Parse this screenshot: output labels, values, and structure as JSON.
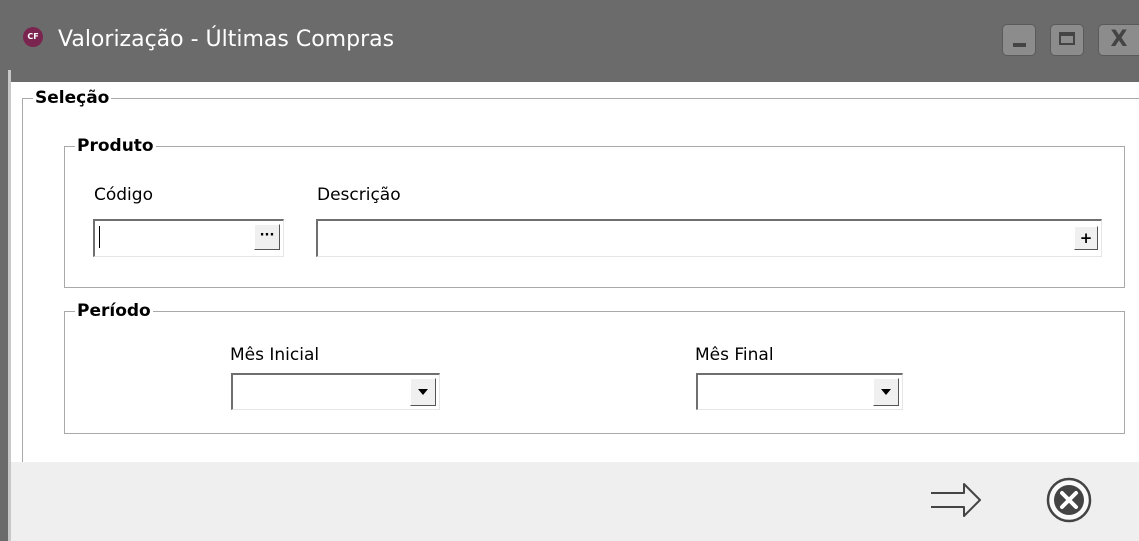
{
  "window": {
    "title": "Valorização - Últimas Compras",
    "app_icon_text": "CF",
    "close_glyph": "X"
  },
  "selecao": {
    "legend": "Seleção",
    "produto": {
      "legend": "Produto",
      "codigo_label": "Código",
      "codigo_value": "",
      "codigo_button": "···",
      "descricao_label": "Descrição",
      "descricao_value": "",
      "descricao_button": "+"
    },
    "periodo": {
      "legend": "Período",
      "mes_inicial_label": "Mês Inicial",
      "mes_inicial_value": "",
      "mes_final_label": "Mês Final",
      "mes_final_value": ""
    }
  },
  "icons": {
    "confirm": "arrow-right-icon",
    "cancel": "cancel-icon"
  },
  "colors": {
    "titlebar": "#6b6b6b",
    "app_icon": "#7a2450",
    "footer": "#efefef"
  }
}
